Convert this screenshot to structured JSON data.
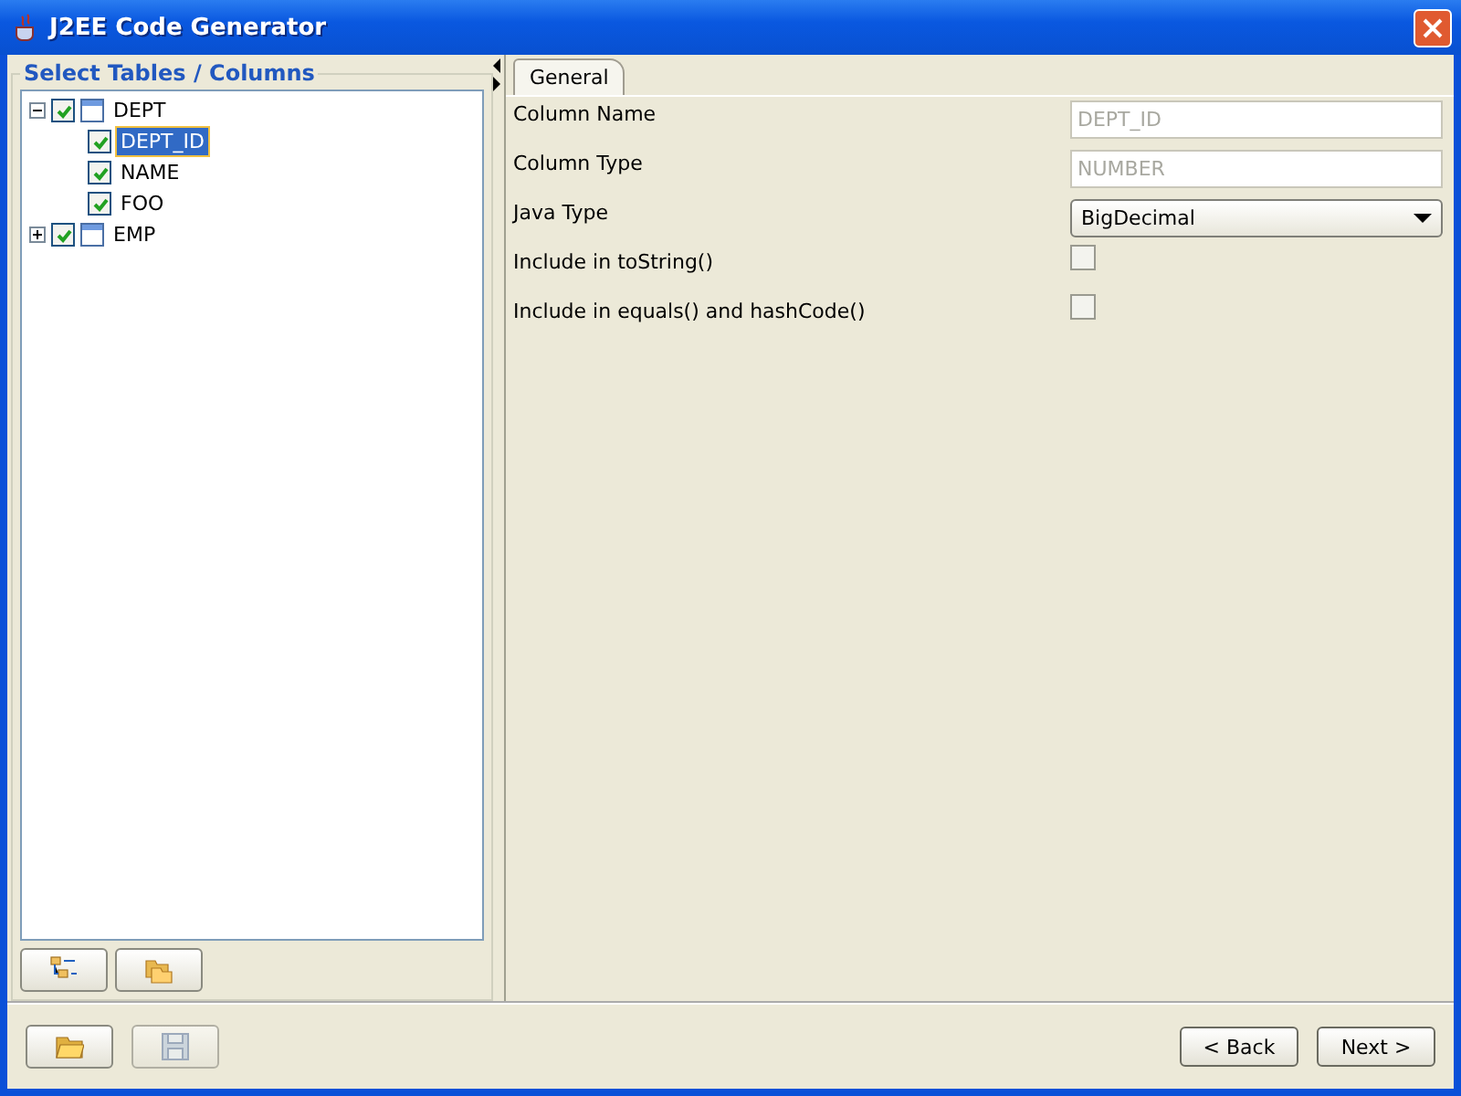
{
  "window": {
    "title": "J2EE Code Generator"
  },
  "left_panel": {
    "title": "Select Tables / Columns",
    "tree": [
      {
        "label": "DEPT",
        "kind": "table",
        "checked": true,
        "expanded": true,
        "selected": false,
        "children": [
          {
            "label": "DEPT_ID",
            "kind": "column",
            "checked": true,
            "selected": true
          },
          {
            "label": "NAME",
            "kind": "column",
            "checked": true,
            "selected": false
          },
          {
            "label": "FOO",
            "kind": "column",
            "checked": true,
            "selected": false
          }
        ]
      },
      {
        "label": "EMP",
        "kind": "table",
        "checked": true,
        "expanded": false,
        "selected": false
      }
    ],
    "buttons": [
      {
        "kind": "tree",
        "disabled": false
      },
      {
        "kind": "folders",
        "disabled": false
      }
    ]
  },
  "tabs": [
    {
      "label": "General",
      "selected": true
    }
  ],
  "properties": [
    {
      "label": "Column Name",
      "kind": "text",
      "value": "DEPT_ID",
      "disabled": true
    },
    {
      "label": "Column Type",
      "kind": "text",
      "value": "NUMBER",
      "disabled": true
    },
    {
      "label": "Java Type",
      "kind": "combo",
      "value": "BigDecimal"
    },
    {
      "label": "Include in toString()",
      "kind": "checkbox",
      "checked": false
    },
    {
      "label": "Include in equals() and hashCode()",
      "kind": "checkbox",
      "checked": false
    }
  ],
  "bottom_bar": {
    "tools": [
      {
        "kind": "open",
        "disabled": false
      },
      {
        "kind": "save",
        "disabled": true
      }
    ],
    "nav": [
      {
        "label": "< Back"
      },
      {
        "label": "Next >"
      }
    ]
  }
}
